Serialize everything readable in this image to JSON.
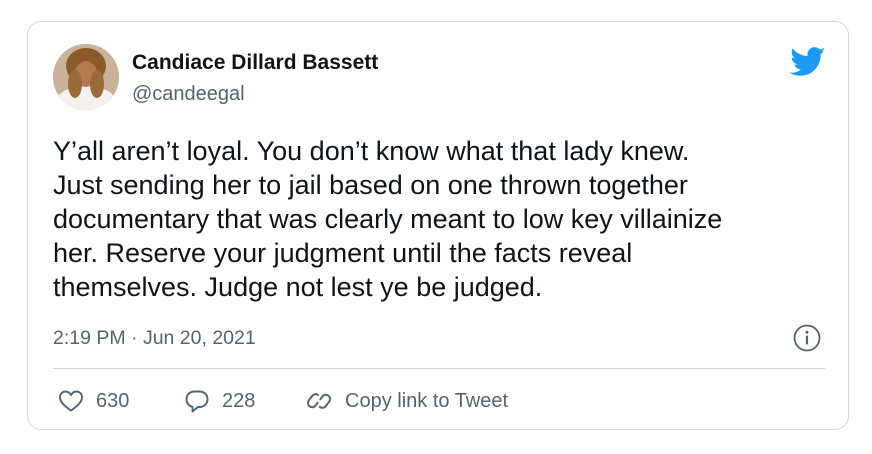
{
  "author": {
    "display_name": "Candiace Dillard Bassett",
    "handle": "@candeegal"
  },
  "tweet": {
    "text": "Y’all aren’t loyal. You don’t know what that lady knew.\nJust sending her to jail based on one thrown together\ndocumentary that was clearly meant to low key villainize\nher. Reserve your judgment until the facts reveal\nthemselves. Judge not lest ye be judged.",
    "timestamp": "2:19 PM · Jun 20, 2021"
  },
  "actions": {
    "like_count": "630",
    "reply_count": "228",
    "copy_link_label": "Copy link to Tweet"
  },
  "icons": {
    "brand": "twitter-bird-icon",
    "info": "info-icon",
    "like": "heart-icon",
    "reply": "speech-bubble-icon",
    "link": "link-icon"
  },
  "colors": {
    "brand_blue": "#1d9bf0",
    "text_primary": "#0f1419",
    "text_secondary": "#536471",
    "border": "#cfd9de"
  }
}
